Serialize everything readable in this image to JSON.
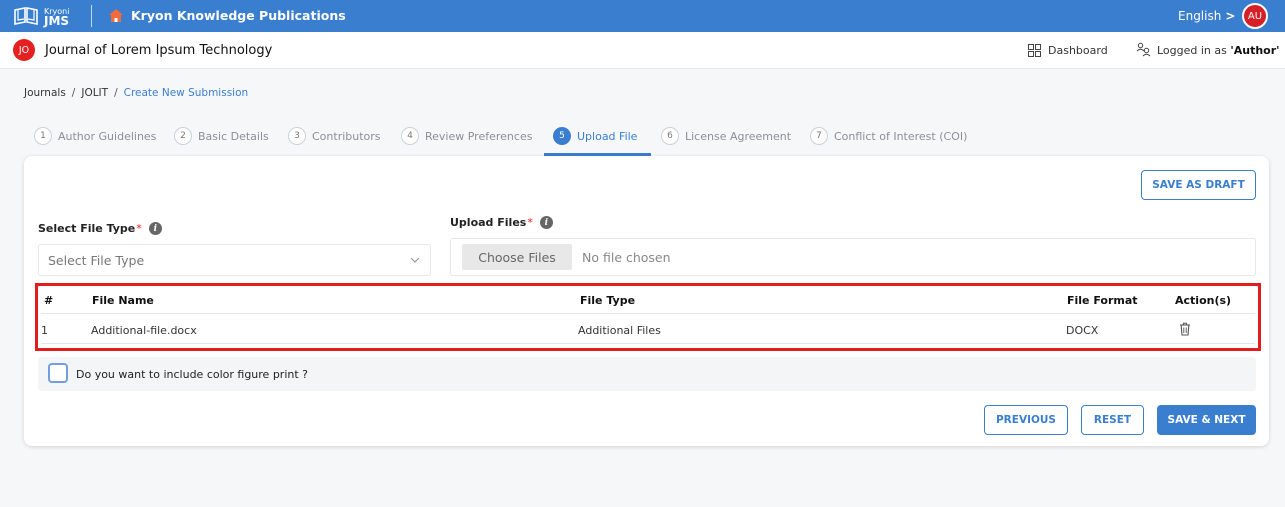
{
  "app": {
    "brand_small": "Kryoni",
    "brand_big": "JMS",
    "publisher": "Kryon Knowledge Publications",
    "language": "English",
    "language_chevron": ">",
    "user_initials": "AU"
  },
  "journal": {
    "badge": "JO",
    "title": "Journal of Lorem Ipsum Technology",
    "dashboard_label": "Dashboard",
    "logged_prefix": "Logged in as ",
    "logged_role": "'Author'"
  },
  "breadcrumb": {
    "items": [
      "Journals",
      "JOLIT",
      "Create New Submission"
    ],
    "separator": "/"
  },
  "steps": [
    {
      "num": "1",
      "label": "Author Guidelines"
    },
    {
      "num": "2",
      "label": "Basic Details"
    },
    {
      "num": "3",
      "label": "Contributors"
    },
    {
      "num": "4",
      "label": "Review Preferences"
    },
    {
      "num": "5",
      "label": "Upload File"
    },
    {
      "num": "6",
      "label": "License Agreement"
    },
    {
      "num": "7",
      "label": "Conflict of Interest (COI)"
    }
  ],
  "active_step": 5,
  "form": {
    "save_draft": "SAVE AS DRAFT",
    "file_type_label": "Select File Type",
    "file_type_placeholder": "Select File Type",
    "upload_label": "Upload Files",
    "required_mark": "*",
    "info_glyph": "i",
    "choose_files": "Choose Files",
    "no_file": "No file chosen"
  },
  "table": {
    "headers": [
      "#",
      "File Name",
      "File Type",
      "File Format",
      "Action(s)"
    ],
    "rows": [
      {
        "index": "1",
        "file_name": "Additional-file.docx",
        "file_type": "Additional Files",
        "file_format": "DOCX",
        "action_icon": "trash-icon"
      }
    ]
  },
  "color_print": {
    "label": "Do you want to include color figure print ?",
    "checked": false
  },
  "footer": {
    "previous": "PREVIOUS",
    "reset": "RESET",
    "save_next": "SAVE & NEXT"
  },
  "colors": {
    "primary": "#3a7ed0",
    "danger": "#e11d1d",
    "avatar": "#d61f26"
  }
}
